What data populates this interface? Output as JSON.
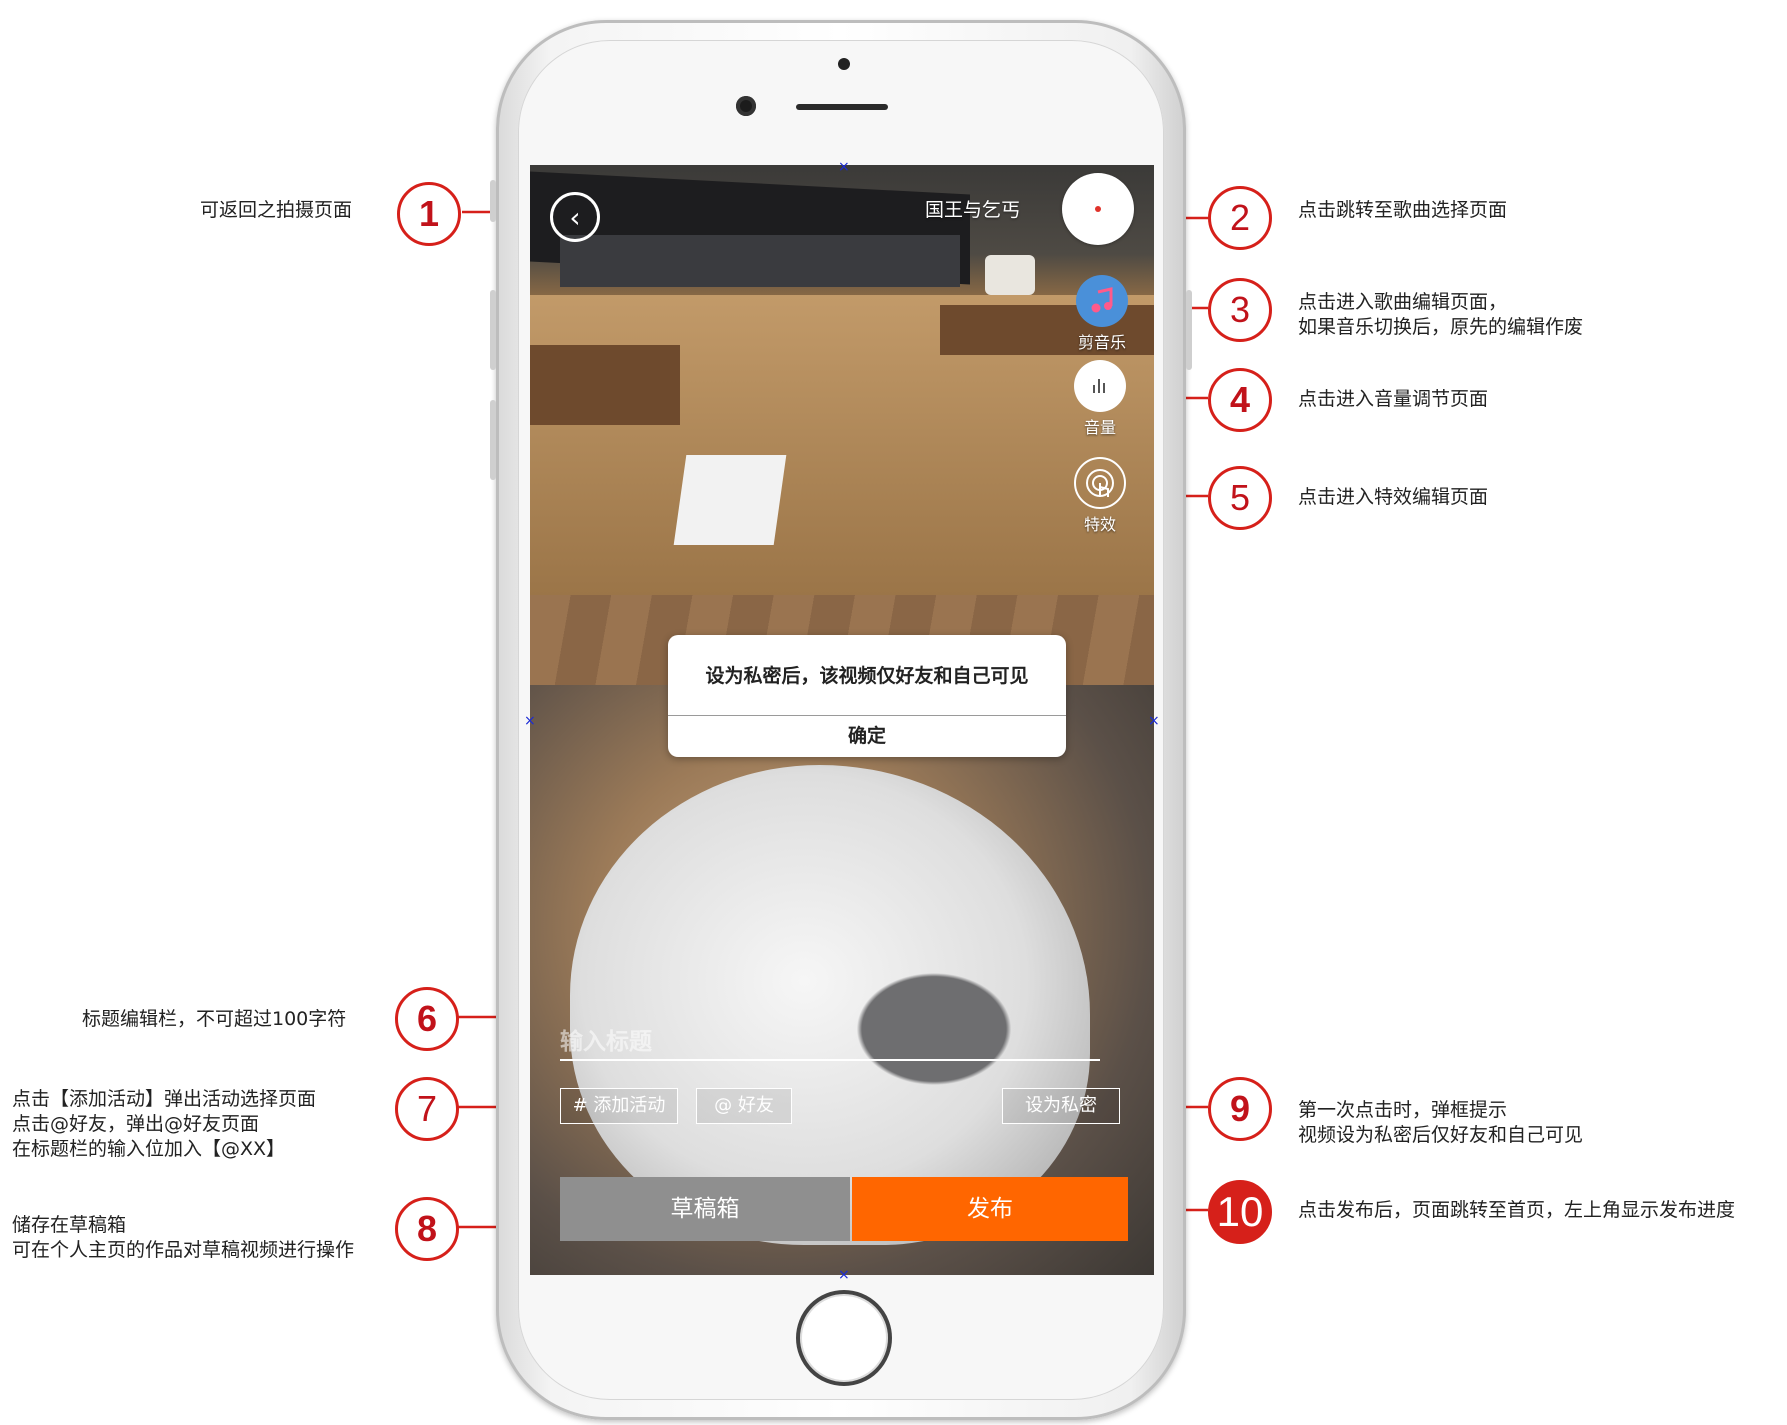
{
  "screen": {
    "song_title": "国王与乞丐",
    "tools": [
      {
        "label": "剪音乐",
        "icon": "music-note-icon"
      },
      {
        "label": "音量",
        "icon": "volume-bars-icon"
      },
      {
        "label": "特效",
        "icon": "touch-effect-icon"
      }
    ],
    "dialog": {
      "message": "设为私密后，该视频仅好友和自己可见",
      "confirm": "确定"
    },
    "title_input": {
      "placeholder": "输入标题",
      "value": ""
    },
    "tags": {
      "activity": "# 添加活动",
      "friend": "@ 好友",
      "private": "设为私密"
    },
    "buttons": {
      "draft": "草稿箱",
      "publish": "发布"
    },
    "colors": {
      "publish": "#ff6600",
      "draft": "#8f8f8f",
      "annotation": "#d6201a",
      "music_icon": "#4a90d9"
    }
  },
  "annotations": [
    {
      "num": "1",
      "text": [
        "可返回之拍摄页面"
      ]
    },
    {
      "num": "2",
      "text": [
        "点击跳转至歌曲选择页面"
      ]
    },
    {
      "num": "3",
      "text": [
        "点击进入歌曲编辑页面，",
        "如果音乐切换后，原先的编辑作废"
      ]
    },
    {
      "num": "4",
      "text": [
        "点击进入音量调节页面"
      ]
    },
    {
      "num": "5",
      "text": [
        "点击进入特效编辑页面"
      ]
    },
    {
      "num": "6",
      "text": [
        "标题编辑栏，不可超过100字符"
      ]
    },
    {
      "num": "7",
      "text": [
        "点击【添加活动】弹出活动选择页面",
        "点击@好友，弹出@好友页面",
        "在标题栏的输入位加入【@XX】"
      ]
    },
    {
      "num": "8",
      "text": [
        "储存在草稿箱",
        "可在个人主页的作品对草稿视频进行操作"
      ]
    },
    {
      "num": "9",
      "text": [
        "第一次点击时，弹框提示",
        "视频设为私密后仅好友和自己可见"
      ]
    },
    {
      "num": "10",
      "text": [
        "点击发布后，页面跳转至首页，左上角显示发布进度"
      ]
    }
  ]
}
